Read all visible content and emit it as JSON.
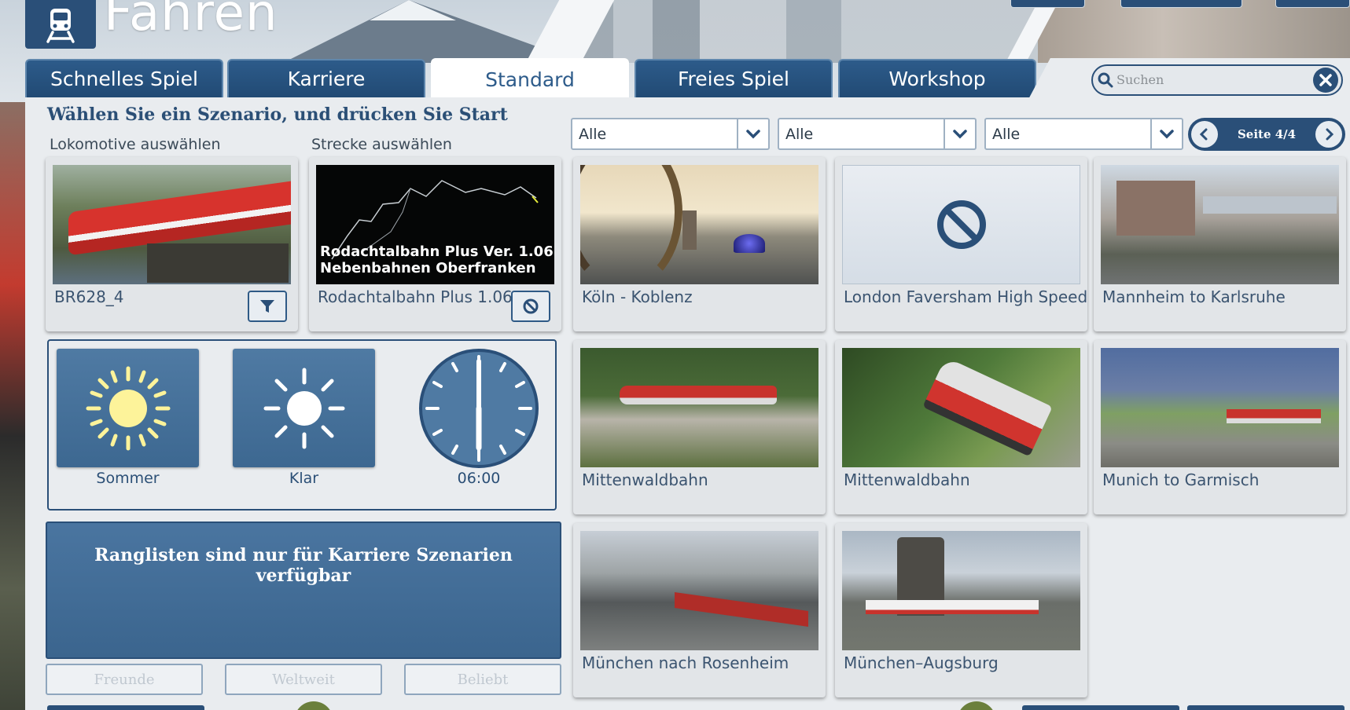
{
  "header": {
    "title": "Fahren",
    "logo_icon": "train-icon"
  },
  "tabs": [
    {
      "label": "Schnelles Spiel",
      "active": false
    },
    {
      "label": "Karriere",
      "active": false
    },
    {
      "label": "Standard",
      "active": true
    },
    {
      "label": "Freies Spiel",
      "active": false
    },
    {
      "label": "Workshop",
      "active": false
    }
  ],
  "search": {
    "placeholder": "Suchen",
    "value": ""
  },
  "main": {
    "heading": "Wählen Sie ein Szenario, und drücken Sie Start",
    "loco_label": "Lokomotive auswählen",
    "route_label": "Strecke auswählen"
  },
  "filters": [
    {
      "value": "Alle"
    },
    {
      "value": "Alle"
    },
    {
      "value": "Alle"
    }
  ],
  "pager": {
    "text": "Seite 4/4"
  },
  "selection": {
    "loco": {
      "name": "BR628_4"
    },
    "route": {
      "name": "Rodachtalbahn Plus 1.06",
      "thumb_caption_line1": "Rodachtalbahn  Plus Ver. 1.06",
      "thumb_caption_line2": "Nebenbahnen Oberfranken"
    }
  },
  "routes": [
    {
      "name": "Köln - Koblenz"
    },
    {
      "name": "London Faversham High Speed"
    },
    {
      "name": "Mannheim to Karlsruhe"
    },
    {
      "name": "Mittenwaldbahn"
    },
    {
      "name": "Mittenwaldbahn"
    },
    {
      "name": "Munich to Garmisch"
    },
    {
      "name": "München nach Rosenheim"
    },
    {
      "name": "München–Augsburg"
    }
  ],
  "conditions": {
    "season": "Sommer",
    "weather": "Klar",
    "time": "06:00"
  },
  "leaderboard": {
    "message": "Ranglisten sind nur für Karriere Szenarien verfügbar",
    "buttons": [
      "Freunde",
      "Weltweit",
      "Beliebt"
    ]
  },
  "colors": {
    "accent": "#2a4f78",
    "tab": "#2d5b8a",
    "panel": "#e9ecef",
    "sun": "#fdf39a"
  }
}
